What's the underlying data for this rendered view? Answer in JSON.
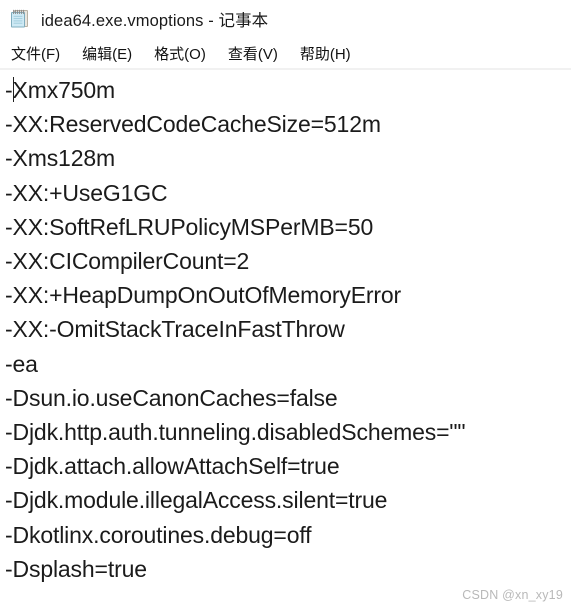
{
  "window": {
    "title": "idea64.exe.vmoptions - 记事本",
    "icon": "notepad-icon"
  },
  "menubar": {
    "items": [
      {
        "label": "文件(F)",
        "name": "menu-file"
      },
      {
        "label": "编辑(E)",
        "name": "menu-edit"
      },
      {
        "label": "格式(O)",
        "name": "menu-format"
      },
      {
        "label": "查看(V)",
        "name": "menu-view"
      },
      {
        "label": "帮助(H)",
        "name": "menu-help"
      }
    ]
  },
  "editor": {
    "caret_line": 0,
    "caret_column": 1,
    "lines": [
      "-Xmx750m",
      "-XX:ReservedCodeCacheSize=512m",
      "-Xms128m",
      "-XX:+UseG1GC",
      "-XX:SoftRefLRUPolicyMSPerMB=50",
      "-XX:CICompilerCount=2",
      "-XX:+HeapDumpOnOutOfMemoryError",
      "-XX:-OmitStackTraceInFastThrow",
      "-ea",
      "-Dsun.io.useCanonCaches=false",
      "-Djdk.http.auth.tunneling.disabledSchemes=\"\"",
      "-Djdk.attach.allowAttachSelf=true",
      "-Djdk.module.illegalAccess.silent=true",
      "-Dkotlinx.coroutines.debug=off",
      "-Dsplash=true"
    ],
    "caret_prefix": "-",
    "caret_suffix": "Xmx750m"
  },
  "watermark": {
    "text": "CSDN @xn_xy19"
  },
  "colors": {
    "background": "#ffffff",
    "text": "#1b1b1b",
    "title_text": "#1a1a1a",
    "separator": "#f1f1f1",
    "watermark": "#b9b9b9",
    "icon_fill": "#bfe4f2",
    "icon_stroke": "#8fb8c8"
  }
}
